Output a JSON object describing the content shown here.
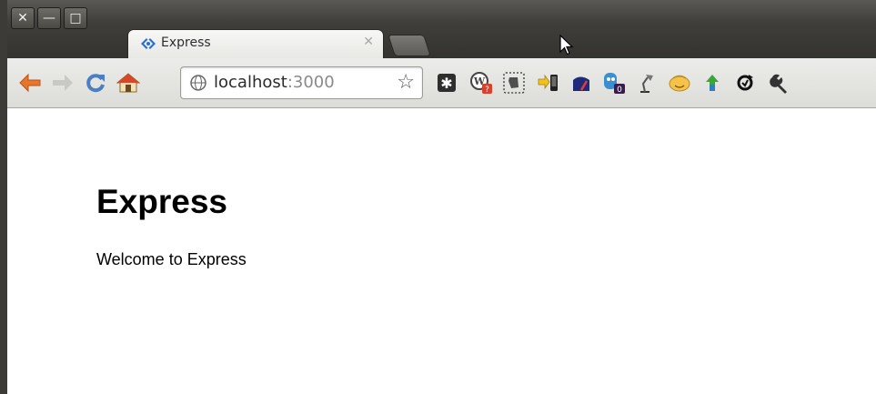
{
  "window": {
    "buttons": [
      {
        "name": "close-window-icon",
        "glyph": "✕"
      },
      {
        "name": "minimize-window-icon",
        "glyph": "—"
      },
      {
        "name": "maximize-window-icon",
        "glyph": "□"
      }
    ]
  },
  "tab": {
    "title": "Express",
    "close_glyph": "✕"
  },
  "toolbar": {
    "omnibox_host": "localhost",
    "omnibox_port": ":3000",
    "star_glyph": "☆",
    "extensions": [
      "asterisk-extension-icon",
      "wordpress-extension-icon",
      "evernote-extension-icon",
      "send-to-phone-extension-icon",
      "speed-meter-extension-icon",
      "counter-extension-icon",
      "lamp-extension-icon",
      "smiley-extension-icon",
      "arrow-extension-icon",
      "sync-extension-icon",
      "wrench-icon"
    ],
    "badges": {
      "wordpress": "?",
      "counter": "0"
    }
  },
  "page": {
    "title": "Express",
    "text": "Welcome to Express"
  },
  "colors": {
    "tabstrip": "#3f3e3a",
    "back_arrow": "#e8752c",
    "reload": "#4a7fc4",
    "home_roof": "#d9472b"
  }
}
